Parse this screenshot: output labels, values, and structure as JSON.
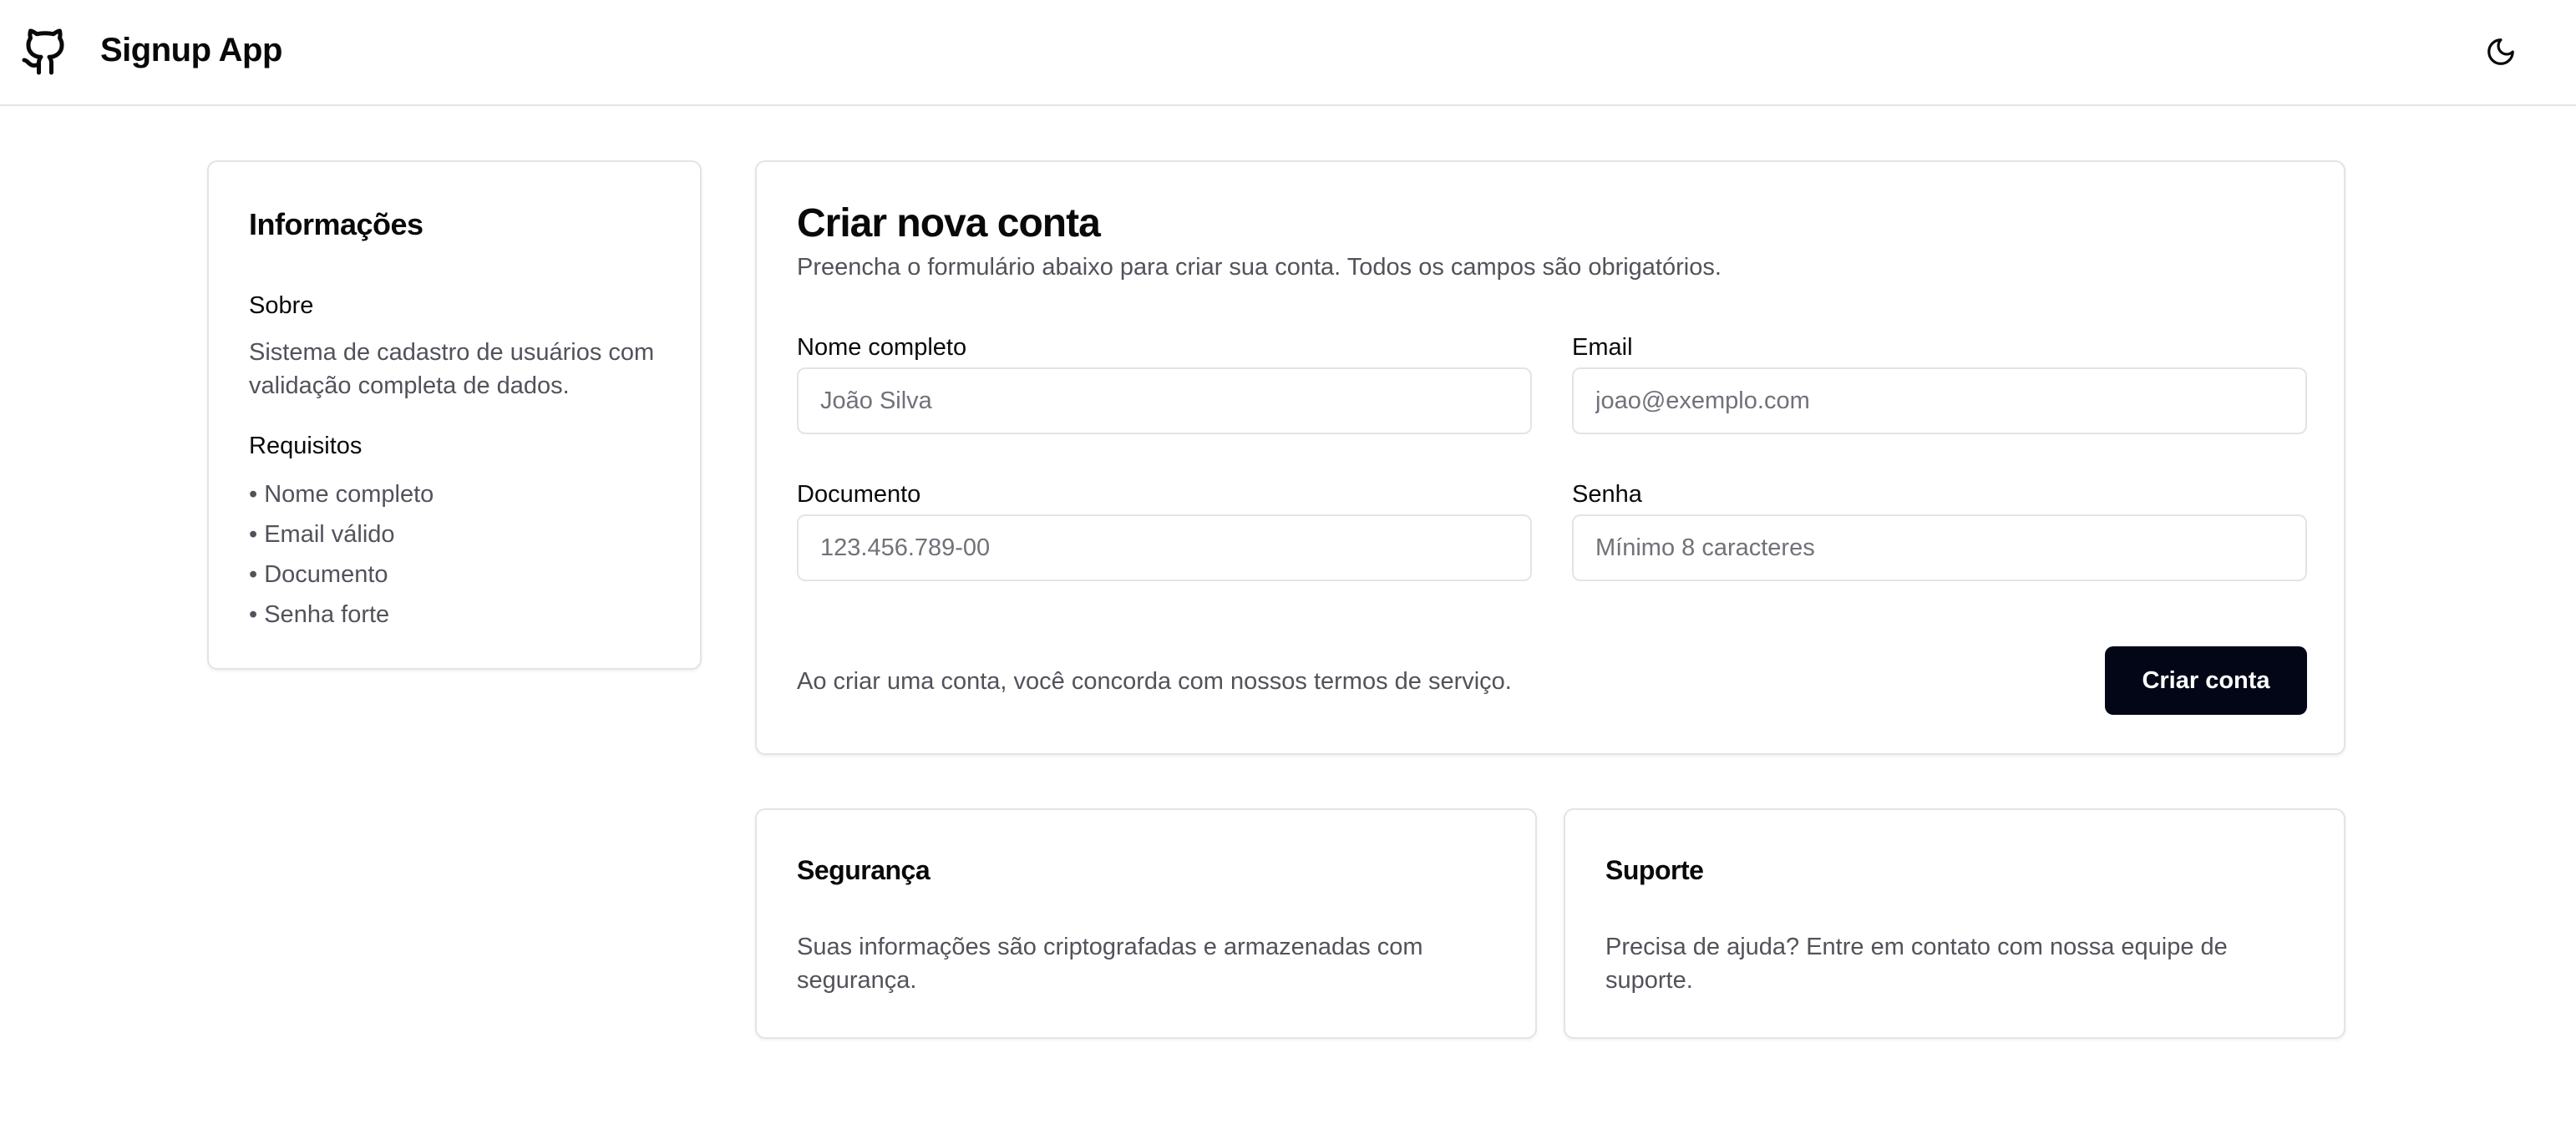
{
  "header": {
    "app_title": "Signup App",
    "logo_icon": "github-icon",
    "theme_toggle_icon": "moon-icon"
  },
  "info": {
    "title": "Informações",
    "about_label": "Sobre",
    "about_text": "Sistema de cadastro de usuários com validação completa de dados.",
    "requirements_label": "Requisitos",
    "requirements": [
      "Nome completo",
      "Email válido",
      "Documento",
      "Senha forte"
    ]
  },
  "form": {
    "title": "Criar nova conta",
    "subtitle": "Preencha o formulário abaixo para criar sua conta. Todos os campos são obrigatórios.",
    "fields": {
      "name": {
        "label": "Nome completo",
        "placeholder": "João Silva",
        "value": ""
      },
      "email": {
        "label": "Email",
        "placeholder": "joao@exemplo.com",
        "value": ""
      },
      "document": {
        "label": "Documento",
        "placeholder": "123.456.789-00",
        "value": ""
      },
      "password": {
        "label": "Senha",
        "placeholder": "Mínimo 8 caracteres",
        "value": ""
      }
    },
    "terms_text": "Ao criar uma conta, você concorda com nossos termos de serviço.",
    "submit_label": "Criar conta"
  },
  "security": {
    "title": "Segurança",
    "text": "Suas informações são criptografadas e armazenadas com segurança."
  },
  "support": {
    "title": "Suporte",
    "text": "Precisa de ajuda? Entre em contato com nossa equipe de suporte."
  },
  "colors": {
    "primary_button": "#020617",
    "border": "#e4e4e7",
    "muted_text": "#52525b"
  }
}
